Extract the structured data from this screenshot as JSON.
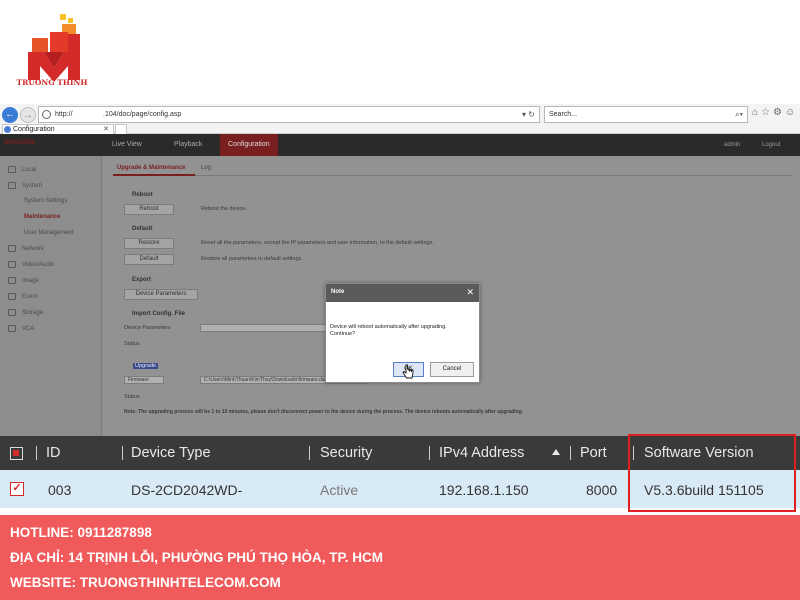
{
  "logo": {
    "text": "TRUONG THINH"
  },
  "browser": {
    "url_host": "http://",
    "url_path": ".104/doc/page/config.asp",
    "url_controls": "▾ ↻",
    "search_placeholder": "Search...",
    "search_controls": "⌕▾",
    "tab_title": "Configuration",
    "tab_close": "✕"
  },
  "app": {
    "brand": "HIKVISION",
    "menu": [
      "Live View",
      "Playback",
      "Configuration"
    ],
    "user": {
      "admin": "admin",
      "logout": "Logout"
    },
    "sidebar": {
      "local": "Local",
      "system": "System",
      "system_settings": "System Settings",
      "maintenance": "Maintenance",
      "user_management": "User Management",
      "network": "Network",
      "video_audio": "Video/Audio",
      "image": "Image",
      "event": "Event",
      "storage": "Storage",
      "vca": "VCA"
    },
    "tabs": {
      "upgrade": "Upgrade & Maintenance",
      "log": "Log"
    },
    "reboot": {
      "title": "Reboot",
      "button": "Reboot",
      "desc": "Reboot the device."
    },
    "default": {
      "title": "Default",
      "restore_button": "Restore",
      "restore_desc": "Reset all the parameters, except the IP parameters and user information, to the default settings.",
      "default_button": "Default",
      "default_desc": "Restore all parameters to default settings."
    },
    "export": {
      "title": "Export",
      "button": "Device Parameters"
    },
    "import": {
      "title": "Import Config. File",
      "param_label": "Device Parameters",
      "status_label": "Status"
    },
    "upgrade": {
      "label": "Upgrade",
      "select": "Firmware",
      "path": "C:\\Users\\MinhThuan\\KimThuy\\Downloads\\firmware.dav",
      "button": "Upgrade",
      "status_label": "Status"
    },
    "note": "Note: The upgrading process will be 1 to 10 minutes, please don't disconnect power to the device during the process. The device reboots automatically after upgrading."
  },
  "modal": {
    "title": "Note",
    "close": "✕",
    "message": "Device will reboot automatically after upgrading. Continue?",
    "ok": "OK",
    "cancel": "Cancel"
  },
  "device_table": {
    "headers": {
      "id": "ID",
      "device_type": "Device Type",
      "security": "Security",
      "ipv4": "IPv4 Address",
      "port": "Port",
      "software_version": "Software Version"
    },
    "row": {
      "check": "✓",
      "id": "003",
      "device_type": "DS-2CD2042WD-",
      "security": "Active",
      "ipv4": "192.168.1.150",
      "port": "8000",
      "software_version": "V5.3.6build 151105"
    }
  },
  "footer": {
    "hotline": "HOTLINE: 0911287898",
    "address": "ĐỊA CHỈ: 14 TRỊNH LỖI, PHƯỜNG PHÚ THỌ HÒA, TP. HCM",
    "website": "WEBSITE: TRUONGTHINHTELECOM.COM"
  },
  "colors": {
    "brand_red": "#d42a2a",
    "footer_red": "#f05a5a",
    "highlight_red": "#e02020",
    "table_header": "#3a3a3a",
    "row_bg": "#d9eaf7"
  }
}
